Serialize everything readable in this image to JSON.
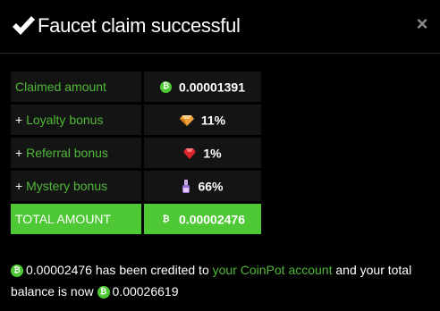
{
  "dialog": {
    "title": "Faucet claim successful",
    "close_label": "×"
  },
  "rows": [
    {
      "prefix": "",
      "label": "Claimed amount",
      "icon": "bitcoin-coin-icon",
      "value": "0.00001391"
    },
    {
      "prefix": "+ ",
      "label": "Loyalty bonus",
      "icon": "loyalty-gem-icon",
      "value": "11%"
    },
    {
      "prefix": "+ ",
      "label": "Referral bonus",
      "icon": "ruby-icon",
      "value": "1%"
    },
    {
      "prefix": "+ ",
      "label": "Mystery bonus",
      "icon": "potion-icon",
      "value": "66%"
    }
  ],
  "total": {
    "label": "TOTAL AMOUNT",
    "icon": "bitcoin-coin-icon",
    "value": "0.00002476"
  },
  "message": {
    "amount": "0.00002476",
    "text1": " has been credited to ",
    "link": "your CoinPot account",
    "text2": " and your total balance is now ",
    "balance": "0.00026619"
  },
  "colors": {
    "accent": "#4ec935",
    "background": "#000000",
    "cell": "#141414"
  }
}
